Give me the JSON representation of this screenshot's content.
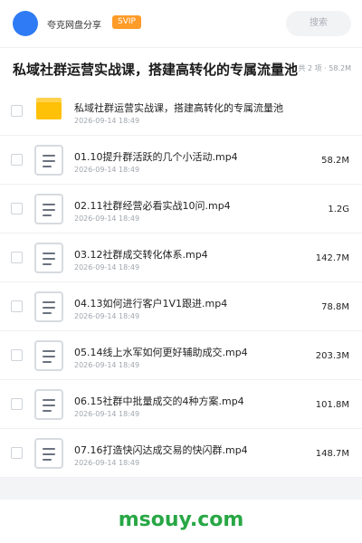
{
  "header": {
    "share_name": "夸克网盘分享",
    "badge": "SVIP",
    "search_label": "搜索",
    "accent_color": "#2f7bf5"
  },
  "title_bar": {
    "title": "私域社群运营实战课，搭建高转化的专属流量池",
    "meta": "共 2 项 · 58.2M"
  },
  "items": [
    {
      "type": "folder",
      "name": "私域社群运营实战课，搭建高转化的专属流量池",
      "date": "2026-09-14 18:49",
      "size": ""
    },
    {
      "type": "file",
      "name": "01.10提升群活跃的几个小活动.mp4",
      "date": "2026-09-14 18:49",
      "size": "58.2M"
    },
    {
      "type": "file",
      "name": "02.11社群经营必看实战10问.mp4",
      "date": "2026-09-14 18:49",
      "size": "1.2G"
    },
    {
      "type": "file",
      "name": "03.12社群成交转化体系.mp4",
      "date": "2026-09-14 18:49",
      "size": "142.7M"
    },
    {
      "type": "file",
      "name": "04.13如何进行客户1V1跟进.mp4",
      "date": "2026-09-14 18:49",
      "size": "78.8M"
    },
    {
      "type": "file",
      "name": "05.14线上水军如何更好辅助成交.mp4",
      "date": "2026-09-14 18:49",
      "size": "203.3M"
    },
    {
      "type": "file",
      "name": "06.15社群中批量成交的4种方案.mp4",
      "date": "2026-09-14 18:49",
      "size": "101.8M"
    },
    {
      "type": "file",
      "name": "07.16打造快闪达成交易的快闪群.mp4",
      "date": "2026-09-14 18:49",
      "size": "148.7M"
    }
  ],
  "footer": {
    "watermark": "msouy.com"
  }
}
